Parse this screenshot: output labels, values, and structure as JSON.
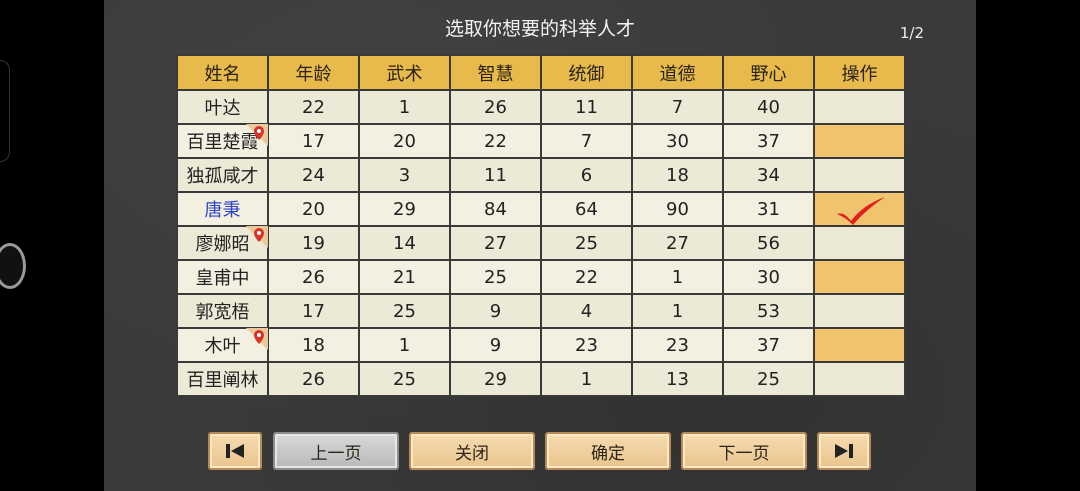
{
  "title": "选取你想要的科举人才",
  "page_indicator": "1/2",
  "columns": [
    "姓名",
    "年龄",
    "武术",
    "智慧",
    "统御",
    "道德",
    "野心",
    "操作"
  ],
  "rows": [
    {
      "name": "叶达",
      "age": "22",
      "martial": "1",
      "wisdom": "26",
      "command": "11",
      "morality": "7",
      "ambition": "40",
      "pin": false,
      "selected": false
    },
    {
      "name": "百里楚霞",
      "age": "17",
      "martial": "20",
      "wisdom": "22",
      "command": "7",
      "morality": "30",
      "ambition": "37",
      "pin": true,
      "selected": false
    },
    {
      "name": "独孤咸才",
      "age": "24",
      "martial": "3",
      "wisdom": "11",
      "command": "6",
      "morality": "18",
      "ambition": "34",
      "pin": false,
      "selected": false
    },
    {
      "name": "唐秉",
      "age": "20",
      "martial": "29",
      "wisdom": "84",
      "command": "64",
      "morality": "90",
      "ambition": "31",
      "pin": false,
      "selected": true
    },
    {
      "name": "廖娜昭",
      "age": "19",
      "martial": "14",
      "wisdom": "27",
      "command": "25",
      "morality": "27",
      "ambition": "56",
      "pin": true,
      "selected": false
    },
    {
      "name": "皇甫中",
      "age": "26",
      "martial": "21",
      "wisdom": "25",
      "command": "22",
      "morality": "1",
      "ambition": "30",
      "pin": false,
      "selected": false
    },
    {
      "name": "郭宽梧",
      "age": "17",
      "martial": "25",
      "wisdom": "9",
      "command": "4",
      "morality": "1",
      "ambition": "53",
      "pin": false,
      "selected": false
    },
    {
      "name": "木叶",
      "age": "18",
      "martial": "1",
      "wisdom": "9",
      "command": "23",
      "morality": "23",
      "ambition": "37",
      "pin": true,
      "selected": false
    },
    {
      "name": "百里阐林",
      "age": "26",
      "martial": "25",
      "wisdom": "29",
      "command": "1",
      "morality": "13",
      "ambition": "25",
      "pin": false,
      "selected": false
    }
  ],
  "buttons": {
    "prev": "上一页",
    "close": "关闭",
    "confirm": "确定",
    "next": "下一页"
  },
  "icons": {
    "first": "skip-first-icon",
    "last": "skip-last-icon",
    "check": "check-icon",
    "pin": "location-pin-icon"
  },
  "colors": {
    "header": "#e8b94b",
    "selected_name": "#2e45c7",
    "check": "#e0201e"
  }
}
